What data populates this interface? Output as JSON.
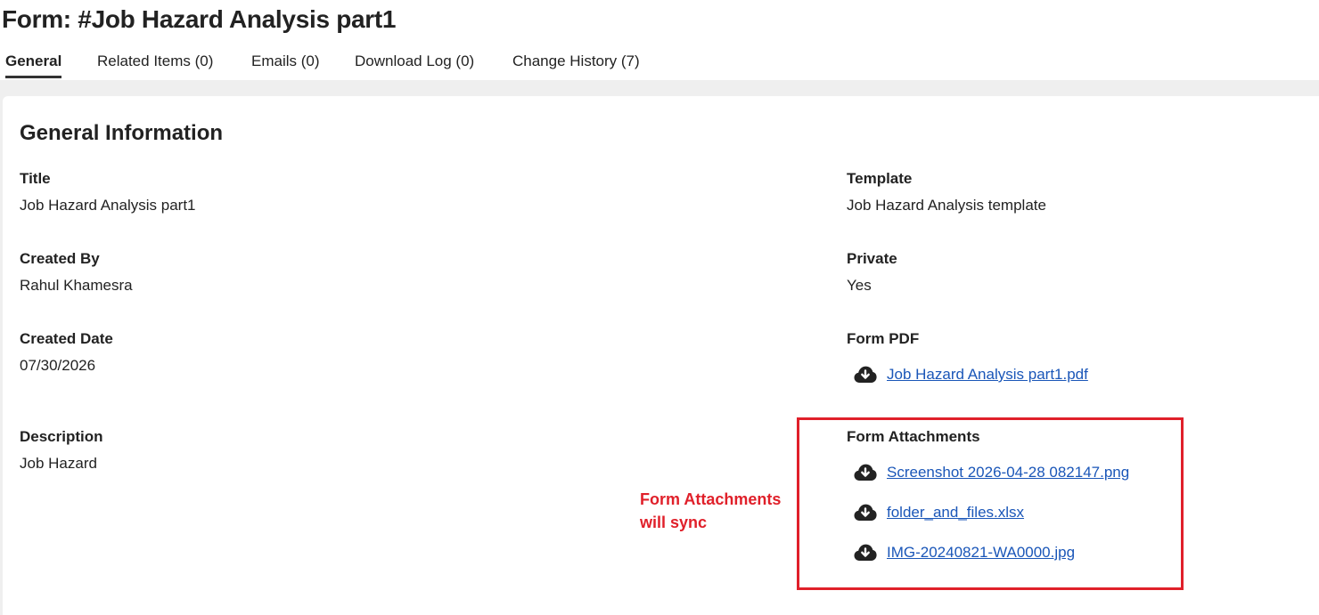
{
  "page_title": "Form: #Job Hazard Analysis part1",
  "tabs": [
    {
      "label": "General",
      "active": true
    },
    {
      "label": "Related Items (0)",
      "active": false
    },
    {
      "label": "Emails (0)",
      "active": false
    },
    {
      "label": "Download Log (0)",
      "active": false
    },
    {
      "label": "Change History (7)",
      "active": false
    }
  ],
  "section_title": "General Information",
  "fields": {
    "title": {
      "label": "Title",
      "value": "Job Hazard Analysis part1"
    },
    "created_by": {
      "label": "Created By",
      "value": "Rahul Khamesra"
    },
    "created_date": {
      "label": "Created Date",
      "value": "07/30/2026"
    },
    "description": {
      "label": "Description",
      "value": "Job Hazard"
    },
    "template": {
      "label": "Template",
      "value": "Job Hazard Analysis template"
    },
    "private": {
      "label": "Private",
      "value": "Yes"
    },
    "form_pdf": {
      "label": "Form PDF",
      "files": [
        "Job Hazard Analysis part1.pdf"
      ]
    },
    "form_attachments": {
      "label": "Form Attachments",
      "files": [
        "Screenshot 2026-04-28 082147.png",
        "folder_and_files.xlsx",
        "IMG-20240821-WA0000.jpg"
      ]
    }
  },
  "annotation": {
    "line1": "Form Attachments",
    "line2": "will sync",
    "color": "#e0202a"
  },
  "icons": {
    "download": "cloud-download-icon"
  },
  "colors": {
    "link": "#1a56b8",
    "highlight": "#e0202a",
    "background": "#efefef"
  }
}
